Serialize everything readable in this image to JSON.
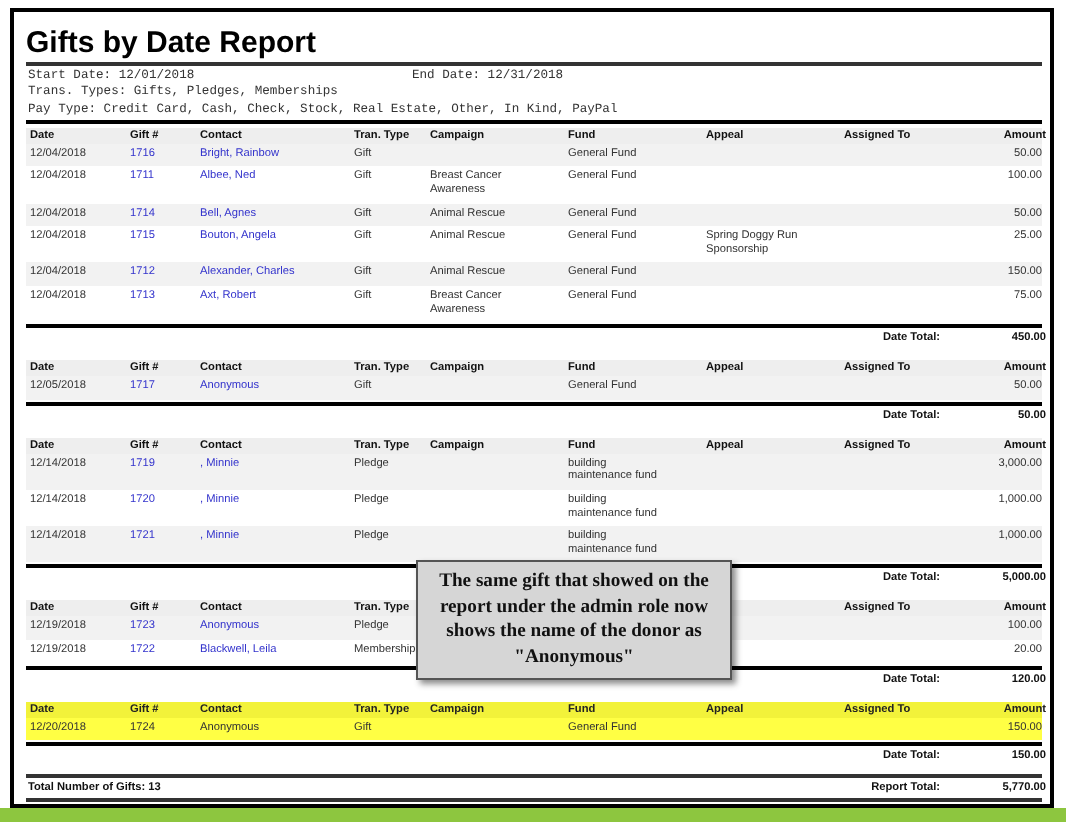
{
  "report": {
    "title": "Gifts by Date Report",
    "start_date": "Start Date: 12/01/2018",
    "end_date": "End Date: 12/31/2018",
    "trans_types": "Trans. Types: Gifts, Pledges, Memberships",
    "pay_type": "Pay Type: Credit Card, Cash, Check, Stock, Real Estate, Other, In Kind, PayPal"
  },
  "groups": [
    {
      "highlighted": false,
      "headers": {
        "date": "Date",
        "gift": "Gift #",
        "contact": "Contact",
        "tran_type": "Tran. Type",
        "campaign": "Campaign",
        "fund": "Fund",
        "appeal": "Appeal",
        "assigned": "Assigned To",
        "amount": "Amount"
      },
      "rows": [
        {
          "date": "12/04/2018",
          "gift": "1716",
          "contact": "Bright, Rainbow",
          "tran_type": "Gift",
          "fund": "General Fund",
          "amount": "50.00"
        },
        {
          "date": "12/04/2018",
          "gift": "1711",
          "contact": "Albee, Ned",
          "tran_type": "Gift",
          "campaign": "Breast Cancer Awareness",
          "fund": "General Fund",
          "amount": "100.00"
        },
        {
          "date": "12/04/2018",
          "gift": "1714",
          "contact": "Bell, Agnes",
          "tran_type": "Gift",
          "campaign": "Animal Rescue",
          "fund": "General Fund",
          "amount": "50.00"
        },
        {
          "date": "12/04/2018",
          "gift": "1715",
          "contact": "Bouton, Angela",
          "tran_type": "Gift",
          "campaign": "Animal Rescue",
          "fund": "General Fund",
          "appeal": "Spring Doggy Run Sponsorship",
          "amount": "25.00"
        },
        {
          "date": "12/04/2018",
          "gift": "1712",
          "contact": "Alexander, Charles",
          "tran_type": "Gift",
          "campaign": "Animal Rescue",
          "fund": "General Fund",
          "amount": "150.00"
        },
        {
          "date": "12/04/2018",
          "gift": "1713",
          "contact": "Axt, Robert",
          "tran_type": "Gift",
          "campaign": "Breast Cancer Awareness",
          "fund": "General Fund",
          "amount": "75.00"
        }
      ],
      "total_label": "Date Total:",
      "total": "450.00"
    },
    {
      "highlighted": false,
      "headers": {
        "date": "Date",
        "gift": "Gift #",
        "contact": "Contact",
        "tran_type": "Tran. Type",
        "campaign": "Campaign",
        "fund": "Fund",
        "appeal": "Appeal",
        "assigned": "Assigned To",
        "amount": "Amount"
      },
      "rows": [
        {
          "date": "12/05/2018",
          "gift": "1717",
          "contact": "Anonymous",
          "tran_type": "Gift",
          "fund": "General Fund",
          "amount": "50.00"
        }
      ],
      "total_label": "Date Total:",
      "total": "50.00"
    },
    {
      "highlighted": false,
      "headers": {
        "date": "Date",
        "gift": "Gift #",
        "contact": "Contact",
        "tran_type": "Tran. Type",
        "campaign": "Campaign",
        "fund": "Fund",
        "appeal": "Appeal",
        "assigned": "Assigned To",
        "amount": "Amount"
      },
      "rows": [
        {
          "date": "12/14/2018",
          "gift": "1719",
          "contact": ", Minnie",
          "tran_type": "Pledge",
          "fund": "building maintenance fund",
          "amount": "3,000.00"
        },
        {
          "date": "12/14/2018",
          "gift": "1720",
          "contact": ", Minnie",
          "tran_type": "Pledge",
          "fund": "building maintenance fund",
          "amount": "1,000.00"
        },
        {
          "date": "12/14/2018",
          "gift": "1721",
          "contact": ", Minnie",
          "tran_type": "Pledge",
          "fund": "building maintenance fund",
          "amount": "1,000.00"
        }
      ],
      "total_label": "Date Total:",
      "total": "5,000.00"
    },
    {
      "highlighted": false,
      "headers": {
        "date": "Date",
        "gift": "Gift #",
        "contact": "Contact",
        "tran_type": "Tran. Type",
        "assigned": "Assigned To",
        "amount": "Amount"
      },
      "rows": [
        {
          "date": "12/19/2018",
          "gift": "1723",
          "contact": "Anonymous",
          "tran_type": "Pledge",
          "amount": "100.00"
        },
        {
          "date": "12/19/2018",
          "gift": "1722",
          "contact": "Blackwell, Leila",
          "tran_type": "Membership",
          "amount": "20.00"
        }
      ],
      "total_label": "Date Total:",
      "total": "120.00"
    },
    {
      "highlighted": true,
      "headers": {
        "date": "Date",
        "gift": "Gift #",
        "contact": "Contact",
        "tran_type": "Tran. Type",
        "campaign": "Campaign",
        "fund": "Fund",
        "appeal": "Appeal",
        "assigned": "Assigned To",
        "amount": "Amount"
      },
      "rows": [
        {
          "date": "12/20/2018",
          "gift": "1724",
          "contact": "Anonymous",
          "tran_type": "Gift",
          "fund": "General Fund",
          "amount": "150.00"
        }
      ],
      "total_label": "Date Total:",
      "total": "150.00"
    }
  ],
  "footer": {
    "count": "Total Number of Gifts:  13",
    "total_label": "Report Total:",
    "total": "5,770.00"
  },
  "callout": {
    "text": "The same gift that showed on the report under the admin role now shows the name of the donor as \"Anonymous\""
  }
}
